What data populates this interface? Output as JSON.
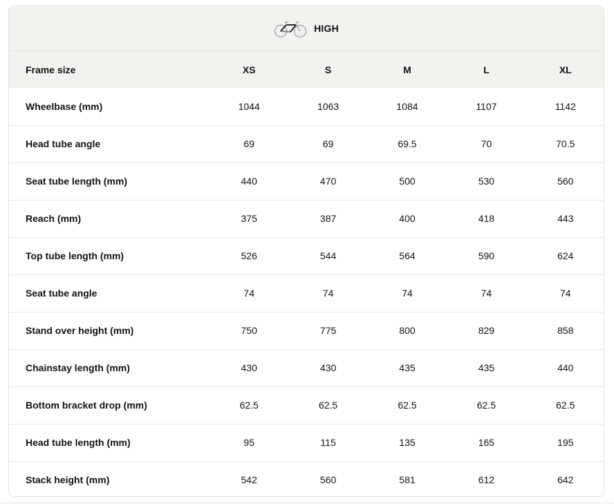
{
  "header": {
    "icon": "road-bike-icon",
    "label": "HIGH"
  },
  "table": {
    "corner_label": "Frame size",
    "sizes": [
      "XS",
      "S",
      "M",
      "L",
      "XL"
    ],
    "rows": [
      {
        "label": "Wheelbase (mm)",
        "values": [
          "1044",
          "1063",
          "1084",
          "1107",
          "1142"
        ]
      },
      {
        "label": "Head tube angle",
        "values": [
          "69",
          "69",
          "69.5",
          "70",
          "70.5"
        ]
      },
      {
        "label": "Seat tube length (mm)",
        "values": [
          "440",
          "470",
          "500",
          "530",
          "560"
        ]
      },
      {
        "label": "Reach (mm)",
        "values": [
          "375",
          "387",
          "400",
          "418",
          "443"
        ]
      },
      {
        "label": "Top tube length (mm)",
        "values": [
          "526",
          "544",
          "564",
          "590",
          "624"
        ]
      },
      {
        "label": "Seat tube angle",
        "values": [
          "74",
          "74",
          "74",
          "74",
          "74"
        ]
      },
      {
        "label": "Stand over height (mm)",
        "values": [
          "750",
          "775",
          "800",
          "829",
          "858"
        ]
      },
      {
        "label": "Chainstay length (mm)",
        "values": [
          "430",
          "430",
          "435",
          "435",
          "440"
        ]
      },
      {
        "label": "Bottom bracket drop (mm)",
        "values": [
          "62.5",
          "62.5",
          "62.5",
          "62.5",
          "62.5"
        ]
      },
      {
        "label": "Head tube length (mm)",
        "values": [
          "95",
          "115",
          "135",
          "165",
          "195"
        ]
      },
      {
        "label": "Stack height (mm)",
        "values": [
          "542",
          "560",
          "581",
          "612",
          "642"
        ]
      }
    ]
  },
  "colors": {
    "header_bg": "#f3f2ef",
    "border": "#e4e2de",
    "text": "#111111"
  }
}
